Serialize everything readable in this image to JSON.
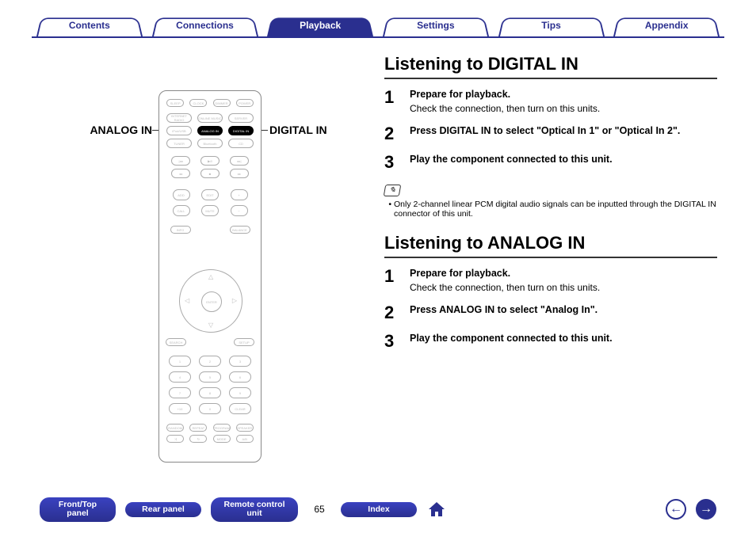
{
  "tabs": {
    "contents": "Contents",
    "connections": "Connections",
    "playback": "Playback",
    "settings": "Settings",
    "tips": "Tips",
    "appendix": "Appendix"
  },
  "remote_labels": {
    "analog_in": "ANALOG IN",
    "digital_in": "DIGITAL IN"
  },
  "digital": {
    "heading": "Listening to DIGITAL IN",
    "steps": [
      {
        "num": "1",
        "bold": "Prepare for playback.",
        "sub": "Check the connection, then turn on this units."
      },
      {
        "num": "2",
        "bold": "Press DIGITAL IN to select \"Optical In 1\" or \"Optical In 2\".",
        "sub": ""
      },
      {
        "num": "3",
        "bold": "Play the component connected to this unit.",
        "sub": ""
      }
    ],
    "note_icon": "✎",
    "notes": [
      "Only 2-channel linear PCM digital audio signals can be inputted through the DIGITAL IN connector of this unit."
    ]
  },
  "analog": {
    "heading": "Listening to ANALOG IN",
    "steps": [
      {
        "num": "1",
        "bold": "Prepare for playback.",
        "sub": "Check the connection, then turn on this units."
      },
      {
        "num": "2",
        "bold": "Press ANALOG IN to select \"Analog In\".",
        "sub": ""
      },
      {
        "num": "3",
        "bold": "Play the component connected to this unit.",
        "sub": ""
      }
    ]
  },
  "footer": {
    "front_top_panel": "Front/Top\npanel",
    "rear_panel": "Rear panel",
    "remote_control_unit": "Remote control\nunit",
    "page": "65",
    "index": "Index"
  }
}
